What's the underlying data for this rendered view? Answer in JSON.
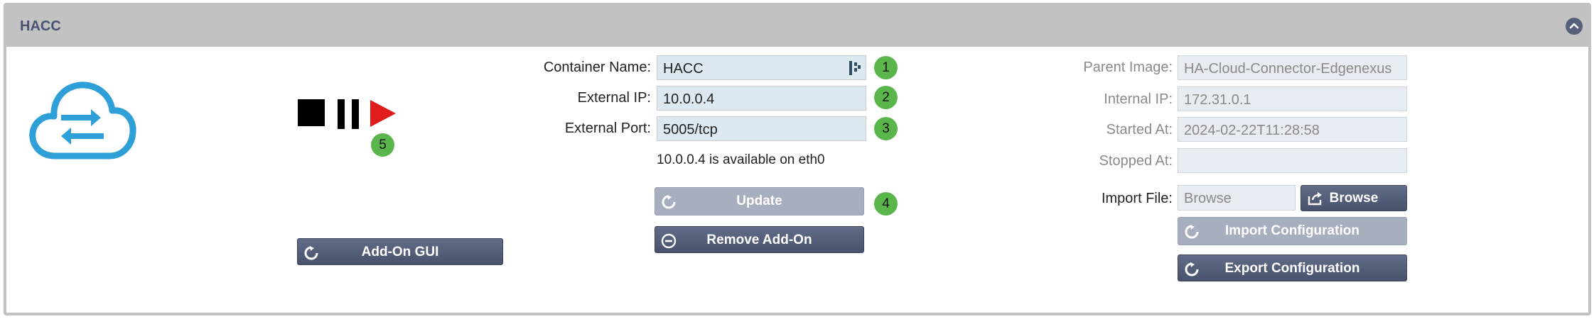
{
  "header": {
    "title": "HACC"
  },
  "controls": {
    "stop": "stop-icon",
    "pause": "pause-icon",
    "play": "play-icon",
    "badge": "5"
  },
  "left": {
    "addon_gui_label": "Add-On GUI"
  },
  "form": {
    "container_name": {
      "label": "Container Name:",
      "value": "HACC",
      "badge": "1"
    },
    "external_ip": {
      "label": "External IP:",
      "value": "10.0.0.4",
      "badge": "2"
    },
    "external_port": {
      "label": "External Port:",
      "value": "5005/tcp",
      "badge": "3"
    },
    "availability": "10.0.0.4 is available on eth0",
    "update_label": "Update",
    "update_badge": "4",
    "remove_label": "Remove Add-On"
  },
  "info": {
    "parent_image": {
      "label": "Parent Image:",
      "value": "HA-Cloud-Connector-Edgenexus"
    },
    "internal_ip": {
      "label": "Internal IP:",
      "value": "172.31.0.1"
    },
    "started_at": {
      "label": "Started At:",
      "value": "2024-02-22T11:28:58"
    },
    "stopped_at": {
      "label": "Stopped At:",
      "value": ""
    },
    "import_file": {
      "label": "Import File:",
      "placeholder": "Browse",
      "browse_label": "Browse"
    },
    "import_config_label": "Import Configuration",
    "export_config_label": "Export Configuration"
  },
  "colors": {
    "accent": "#4a5370",
    "badge": "#5ab64a",
    "cloud": "#2f9fd8",
    "play": "#e01c1c"
  }
}
